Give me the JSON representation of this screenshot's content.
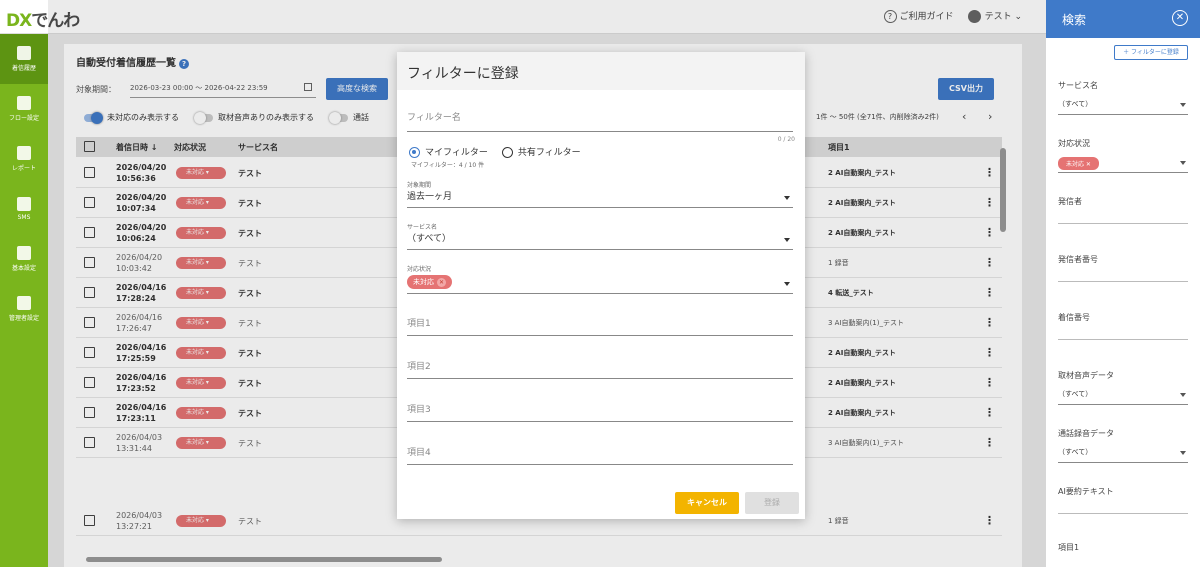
{
  "brand": {
    "logo_a": "DX",
    "logo_b": "でんわ"
  },
  "topbar": {
    "guide": "ご利用ガイド",
    "user": "テスト",
    "help_glyph": "?"
  },
  "sidebar": {
    "items": [
      {
        "label": "着信履歴",
        "active": true
      },
      {
        "label": "フロー設定"
      },
      {
        "label": "レポート"
      },
      {
        "label": "SMS"
      },
      {
        "label": "基本設定"
      },
      {
        "label": "管理者設定"
      }
    ]
  },
  "page": {
    "title": "自動受付着信履歴一覧",
    "period_label": "対象期間：",
    "period_value": "2026-03-23 00:00 ～ 2026-04-22 23:59",
    "advanced_search": "高度な検索",
    "csv": "CSV出力",
    "toggles": [
      "未対応のみ表示する",
      "取材音声ありのみ表示する",
      "通話"
    ],
    "pager": "1件 〜 50件 (全71件、内削除済み2件)"
  },
  "table": {
    "headers": [
      "着信日時 ↓",
      "対応状況",
      "サービス名",
      "項目1"
    ],
    "rows": [
      {
        "date": "2026/04/20",
        "time": "10:56:36",
        "status": "未対応",
        "service": "テスト",
        "item": "2 AI自動案内_テスト",
        "read": false
      },
      {
        "date": "2026/04/20",
        "time": "10:07:34",
        "status": "未対応",
        "service": "テスト",
        "item": "2 AI自動案内_テスト",
        "read": false
      },
      {
        "date": "2026/04/20",
        "time": "10:06:24",
        "status": "未対応",
        "service": "テスト",
        "item": "2 AI自動案内_テスト",
        "read": false
      },
      {
        "date": "2026/04/20",
        "time": "10:03:42",
        "status": "未対応",
        "service": "テスト",
        "item": "1 録音",
        "read": true
      },
      {
        "date": "2026/04/16",
        "time": "17:28:24",
        "status": "未対応",
        "service": "テスト",
        "item": "4 転送_テスト",
        "read": false
      },
      {
        "date": "2026/04/16",
        "time": "17:26:47",
        "status": "未対応",
        "service": "テスト",
        "item": "3 AI自動案内(1)_テスト",
        "read": true
      },
      {
        "date": "2026/04/16",
        "time": "17:25:59",
        "status": "未対応",
        "service": "テスト",
        "item": "2 AI自動案内_テスト",
        "read": false
      },
      {
        "date": "2026/04/16",
        "time": "17:23:52",
        "status": "未対応",
        "service": "テスト",
        "item": "2 AI自動案内_テスト",
        "read": false
      },
      {
        "date": "2026/04/16",
        "time": "17:23:11",
        "status": "未対応",
        "service": "テスト",
        "item": "2 AI自動案内_テスト",
        "read": false
      },
      {
        "date": "2026/04/03",
        "time": "13:31:44",
        "status": "未対応",
        "service": "テスト",
        "item": "3 AI自動案内(1)_テスト",
        "read": true
      },
      {
        "date": "2026/04/03",
        "time": "13:27:21",
        "status": "未対応",
        "service": "テスト",
        "item": "1 録音",
        "read": true
      }
    ]
  },
  "search_panel": {
    "title": "検索",
    "add_filter": "＋ フィルターに登録",
    "fields": [
      {
        "label": "サービス名",
        "value": "（すべて）"
      },
      {
        "label": "対応状況",
        "chip": "未対応"
      },
      {
        "label": "発信者"
      },
      {
        "label": "発信者番号"
      },
      {
        "label": "着信番号"
      },
      {
        "label": "取材音声データ",
        "value": "（すべて）"
      },
      {
        "label": "通話録音データ",
        "value": "（すべて）"
      },
      {
        "label": "AI要約テキスト"
      },
      {
        "label": "項目1"
      }
    ]
  },
  "modal": {
    "title": "フィルターに登録",
    "name_placeholder": "フィルター名",
    "counter": "0 / 20",
    "radio_my": "マイフィルター",
    "radio_shared": "共有フィルター",
    "my_count": "マイフィルター：4 / 10 件",
    "period_label": "対象期間",
    "period_value": "過去一ヶ月",
    "service_label": "サービス名",
    "service_value": "（すべて）",
    "status_label": "対応状況",
    "status_chip": "未対応",
    "item_placeholders": [
      "項目1",
      "項目2",
      "項目3",
      "項目4"
    ],
    "cancel": "キャンセル",
    "register": "登録"
  },
  "colors": {
    "brand_green": "#7ab51d",
    "primary_blue": "#3f7ac9",
    "badge_red": "#e57373",
    "cancel_yellow": "#f3b400"
  }
}
